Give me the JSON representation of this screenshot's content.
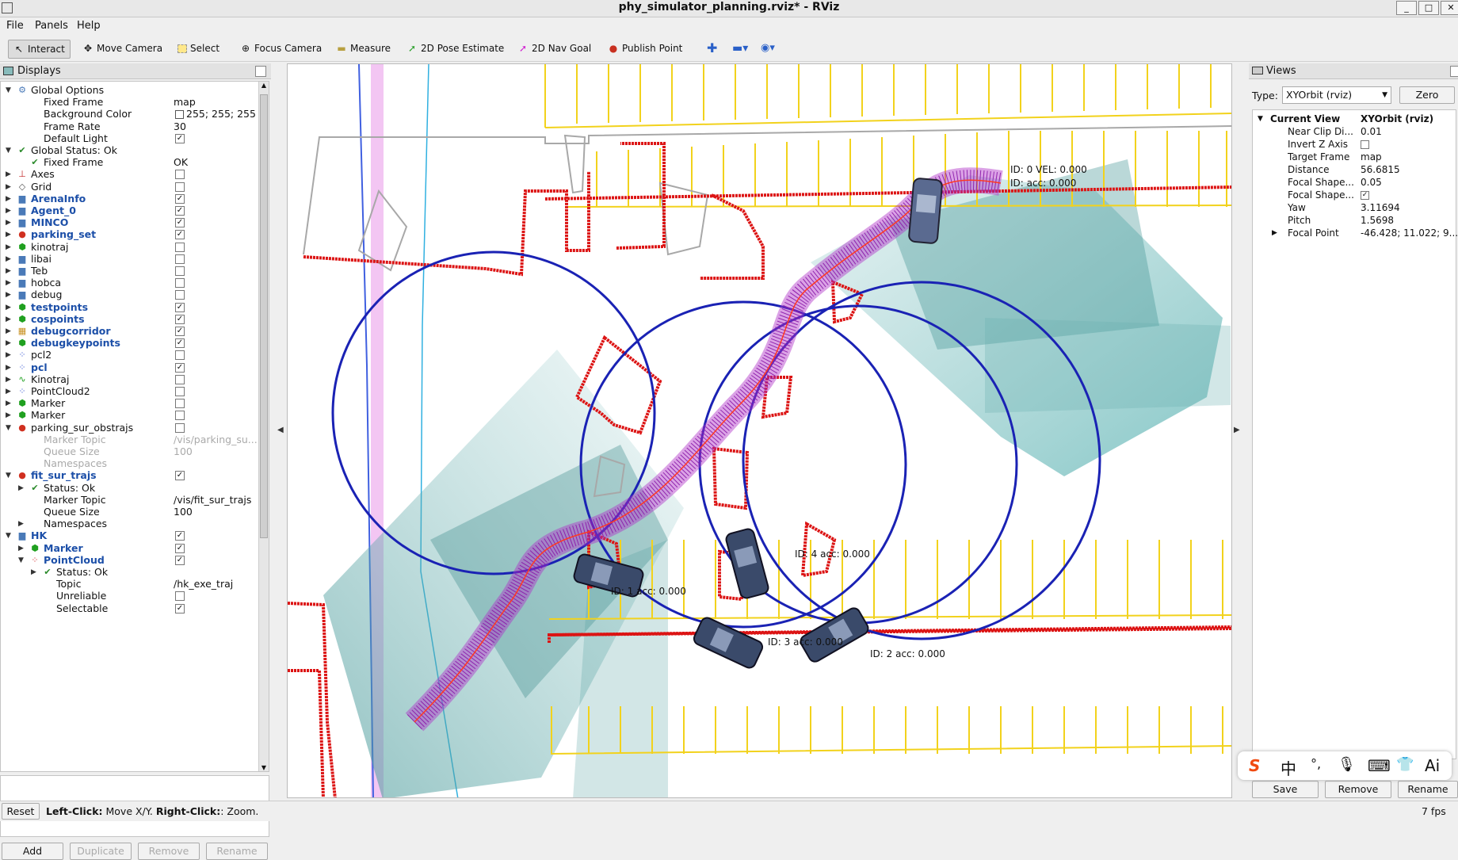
{
  "window": {
    "title": "phy_simulator_planning.rviz* - RViz"
  },
  "menu": {
    "file": "File",
    "panels": "Panels",
    "help": "Help"
  },
  "toolbar": {
    "interact": "Interact",
    "move_camera": "Move Camera",
    "select": "Select",
    "focus_camera": "Focus Camera",
    "measure": "Measure",
    "pose_estimate": "2D Pose Estimate",
    "nav_goal": "2D Nav Goal",
    "publish_point": "Publish Point"
  },
  "displays": {
    "title": "Displays",
    "rows": [
      {
        "label": "Global Options",
        "value": ""
      },
      {
        "label": "Fixed Frame",
        "value": "map"
      },
      {
        "label": "Background Color",
        "value": "255; 255; 255"
      },
      {
        "label": "Frame Rate",
        "value": "30"
      },
      {
        "label": "Default Light",
        "value": ""
      },
      {
        "label": "Global Status: Ok",
        "value": ""
      },
      {
        "label": "Fixed Frame",
        "value": "OK"
      },
      {
        "label": "Axes",
        "value": ""
      },
      {
        "label": "Grid",
        "value": ""
      },
      {
        "label": "ArenaInfo",
        "value": ""
      },
      {
        "label": "Agent_0",
        "value": ""
      },
      {
        "label": "MINCO",
        "value": ""
      },
      {
        "label": "parking_set",
        "value": ""
      },
      {
        "label": "kinotraj",
        "value": ""
      },
      {
        "label": "libai",
        "value": ""
      },
      {
        "label": "Teb",
        "value": ""
      },
      {
        "label": "hobca",
        "value": ""
      },
      {
        "label": "debug",
        "value": ""
      },
      {
        "label": "testpoints",
        "value": ""
      },
      {
        "label": "cospoints",
        "value": ""
      },
      {
        "label": "debugcorridor",
        "value": ""
      },
      {
        "label": "debugkeypoints",
        "value": ""
      },
      {
        "label": "pcl2",
        "value": ""
      },
      {
        "label": "pcl",
        "value": ""
      },
      {
        "label": "Kinotraj",
        "value": ""
      },
      {
        "label": "PointCloud2",
        "value": ""
      },
      {
        "label": "Marker",
        "value": ""
      },
      {
        "label": "Marker",
        "value": ""
      },
      {
        "label": "parking_sur_obstrajs",
        "value": ""
      },
      {
        "label": "Marker Topic",
        "value": "/vis/parking_su..."
      },
      {
        "label": "Queue Size",
        "value": "100"
      },
      {
        "label": "Namespaces",
        "value": ""
      },
      {
        "label": "fit_sur_trajs",
        "value": ""
      },
      {
        "label": "Status: Ok",
        "value": ""
      },
      {
        "label": "Marker Topic",
        "value": "/vis/fit_sur_trajs"
      },
      {
        "label": "Queue Size",
        "value": "100"
      },
      {
        "label": "Namespaces",
        "value": ""
      },
      {
        "label": "HK",
        "value": ""
      },
      {
        "label": "Marker",
        "value": ""
      },
      {
        "label": "PointCloud",
        "value": ""
      },
      {
        "label": "Status: Ok",
        "value": ""
      },
      {
        "label": "Topic",
        "value": "/hk_exe_traj"
      },
      {
        "label": "Unreliable",
        "value": ""
      },
      {
        "label": "Selectable",
        "value": ""
      }
    ],
    "buttons": {
      "add": "Add",
      "duplicate": "Duplicate",
      "remove": "Remove",
      "rename": "Rename"
    }
  },
  "views": {
    "title": "Views",
    "type_label": "Type:",
    "type_value": "XYOrbit (rviz)",
    "zero": "Zero",
    "current_view": "Current View",
    "current_view_type": "XYOrbit (rviz)",
    "props": [
      {
        "label": "Near Clip Di...",
        "value": "0.01"
      },
      {
        "label": "Invert Z Axis",
        "value": ""
      },
      {
        "label": "Target Frame",
        "value": "map"
      },
      {
        "label": "Distance",
        "value": "56.6815"
      },
      {
        "label": "Focal Shape...",
        "value": "0.05"
      },
      {
        "label": "Focal Shape...",
        "value": ""
      },
      {
        "label": "Yaw",
        "value": "3.11694"
      },
      {
        "label": "Pitch",
        "value": "1.5698"
      },
      {
        "label": "Focal Point",
        "value": "-46.428; 11.022; 9...."
      }
    ],
    "buttons": {
      "save": "Save",
      "remove": "Remove",
      "rename": "Rename"
    }
  },
  "scene": {
    "labels": [
      "ID: 0  VEL:  0.000",
      "ID: acc:  0.000",
      "ID:  4     acc:  0.000",
      "ID:  1     acc:  0.000",
      "ID:  3     acc:  0.000",
      "ID:  2     acc:  0.000"
    ]
  },
  "status": {
    "reset": "Reset",
    "hint_left_key": "Left-Click:",
    "hint_left": " Move X/Y. ",
    "hint_right_key": "Right-Click:",
    "hint_right": ": Zoom.",
    "fps": "7 fps"
  },
  "ime": {
    "logo": "S",
    "chinese": "中",
    "punct": "°,",
    "mic": "🎙",
    "kbd": "⌨",
    "shirt": "👕",
    "ai": "Ai"
  }
}
